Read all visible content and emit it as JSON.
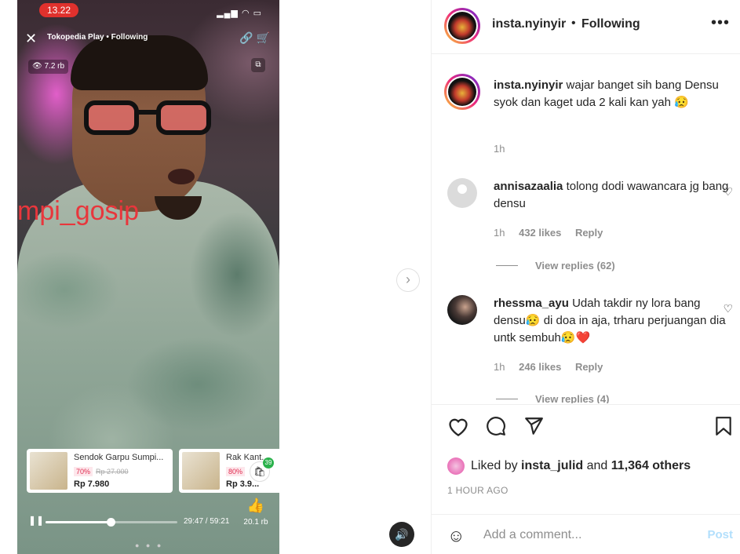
{
  "media": {
    "status_time": "13.22",
    "tokopedia_title": "Tokopedia Play • Following",
    "views": "👁 7.2 rb",
    "watermark": "mpi_gosip",
    "products": [
      {
        "name": "Sendok Garpu Sumpi...",
        "discount": "70%",
        "original": "Rp 27.000",
        "price": "Rp 7.980"
      },
      {
        "name": "Rak Kant...",
        "discount": "80%",
        "original": "",
        "price": "Rp 3.9..."
      }
    ],
    "cart_count": "39",
    "likes": "20.1 rb",
    "progress": 0.51,
    "time": "29:47 / 59:21"
  },
  "header": {
    "username": "insta.nyinyir",
    "separator": "•",
    "follow_status": "Following",
    "more": "•••"
  },
  "caption": {
    "username": "insta.nyinyir",
    "text": "wajar banget sih bang Densu syok dan kaget uda 2 kali kan yah 😥",
    "time": "1h"
  },
  "comments": [
    {
      "username": "annisazaalia",
      "text": "tolong dodi wawancara jg bang densu",
      "time": "1h",
      "likes": "432 likes",
      "reply": "Reply",
      "view_replies": "View replies (62)"
    },
    {
      "username": "rhessma_ayu",
      "text": "Udah takdir ny lora bang densu😥 di doa in aja, trharu perjuangan dia untk sembuh😥❤️",
      "time": "1h",
      "likes": "246 likes",
      "reply": "Reply",
      "view_replies": "View replies (4)"
    }
  ],
  "liked_by": {
    "prefix": "Liked by",
    "user": "insta_julid",
    "middle": "and",
    "others": "11,364 others"
  },
  "posted_ago": "1 HOUR AGO",
  "comment_box": {
    "placeholder": "Add a comment...",
    "post_label": "Post"
  }
}
